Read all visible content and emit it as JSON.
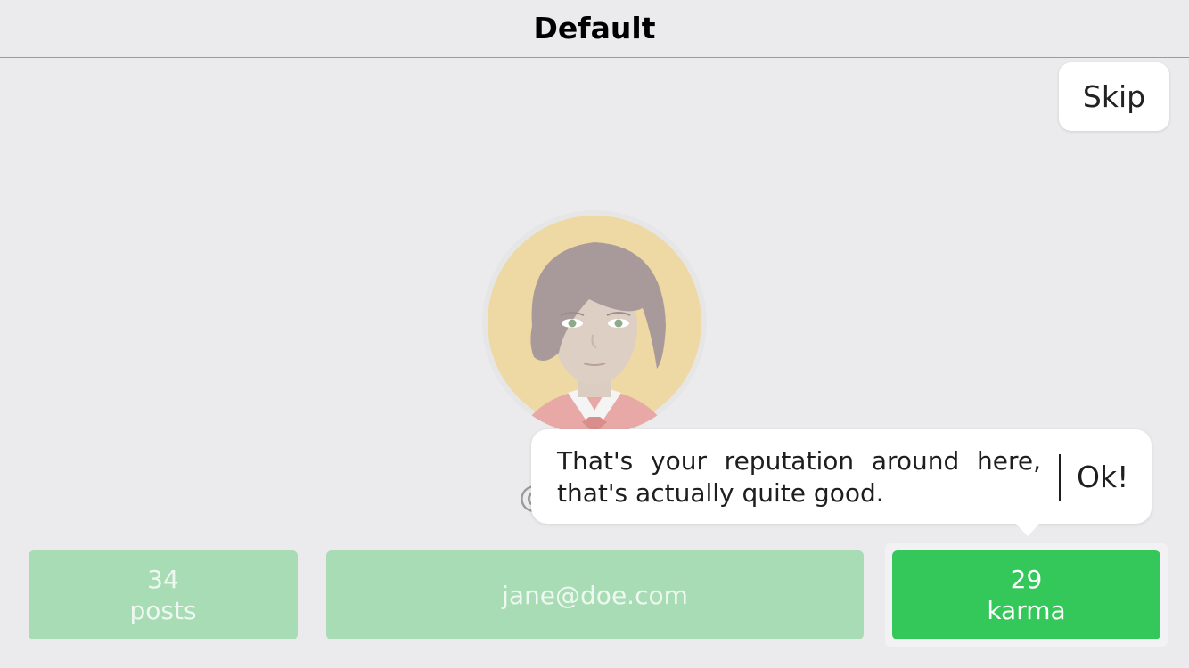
{
  "navbar": {
    "title": "Default"
  },
  "skip_button": {
    "label": "Skip"
  },
  "profile": {
    "handle_prefix": "@"
  },
  "tooltip": {
    "message": "That's your reputation around here, that's actually quite good.",
    "ok_label": "Ok!"
  },
  "stats": {
    "posts": {
      "value": "34",
      "label": "posts"
    },
    "email": {
      "value": "jane@doe.com"
    },
    "karma": {
      "value": "29",
      "label": "karma"
    }
  },
  "colors": {
    "accent_green": "#34c759",
    "dim_green": "#a8dcb4",
    "background": "#ebebed"
  }
}
